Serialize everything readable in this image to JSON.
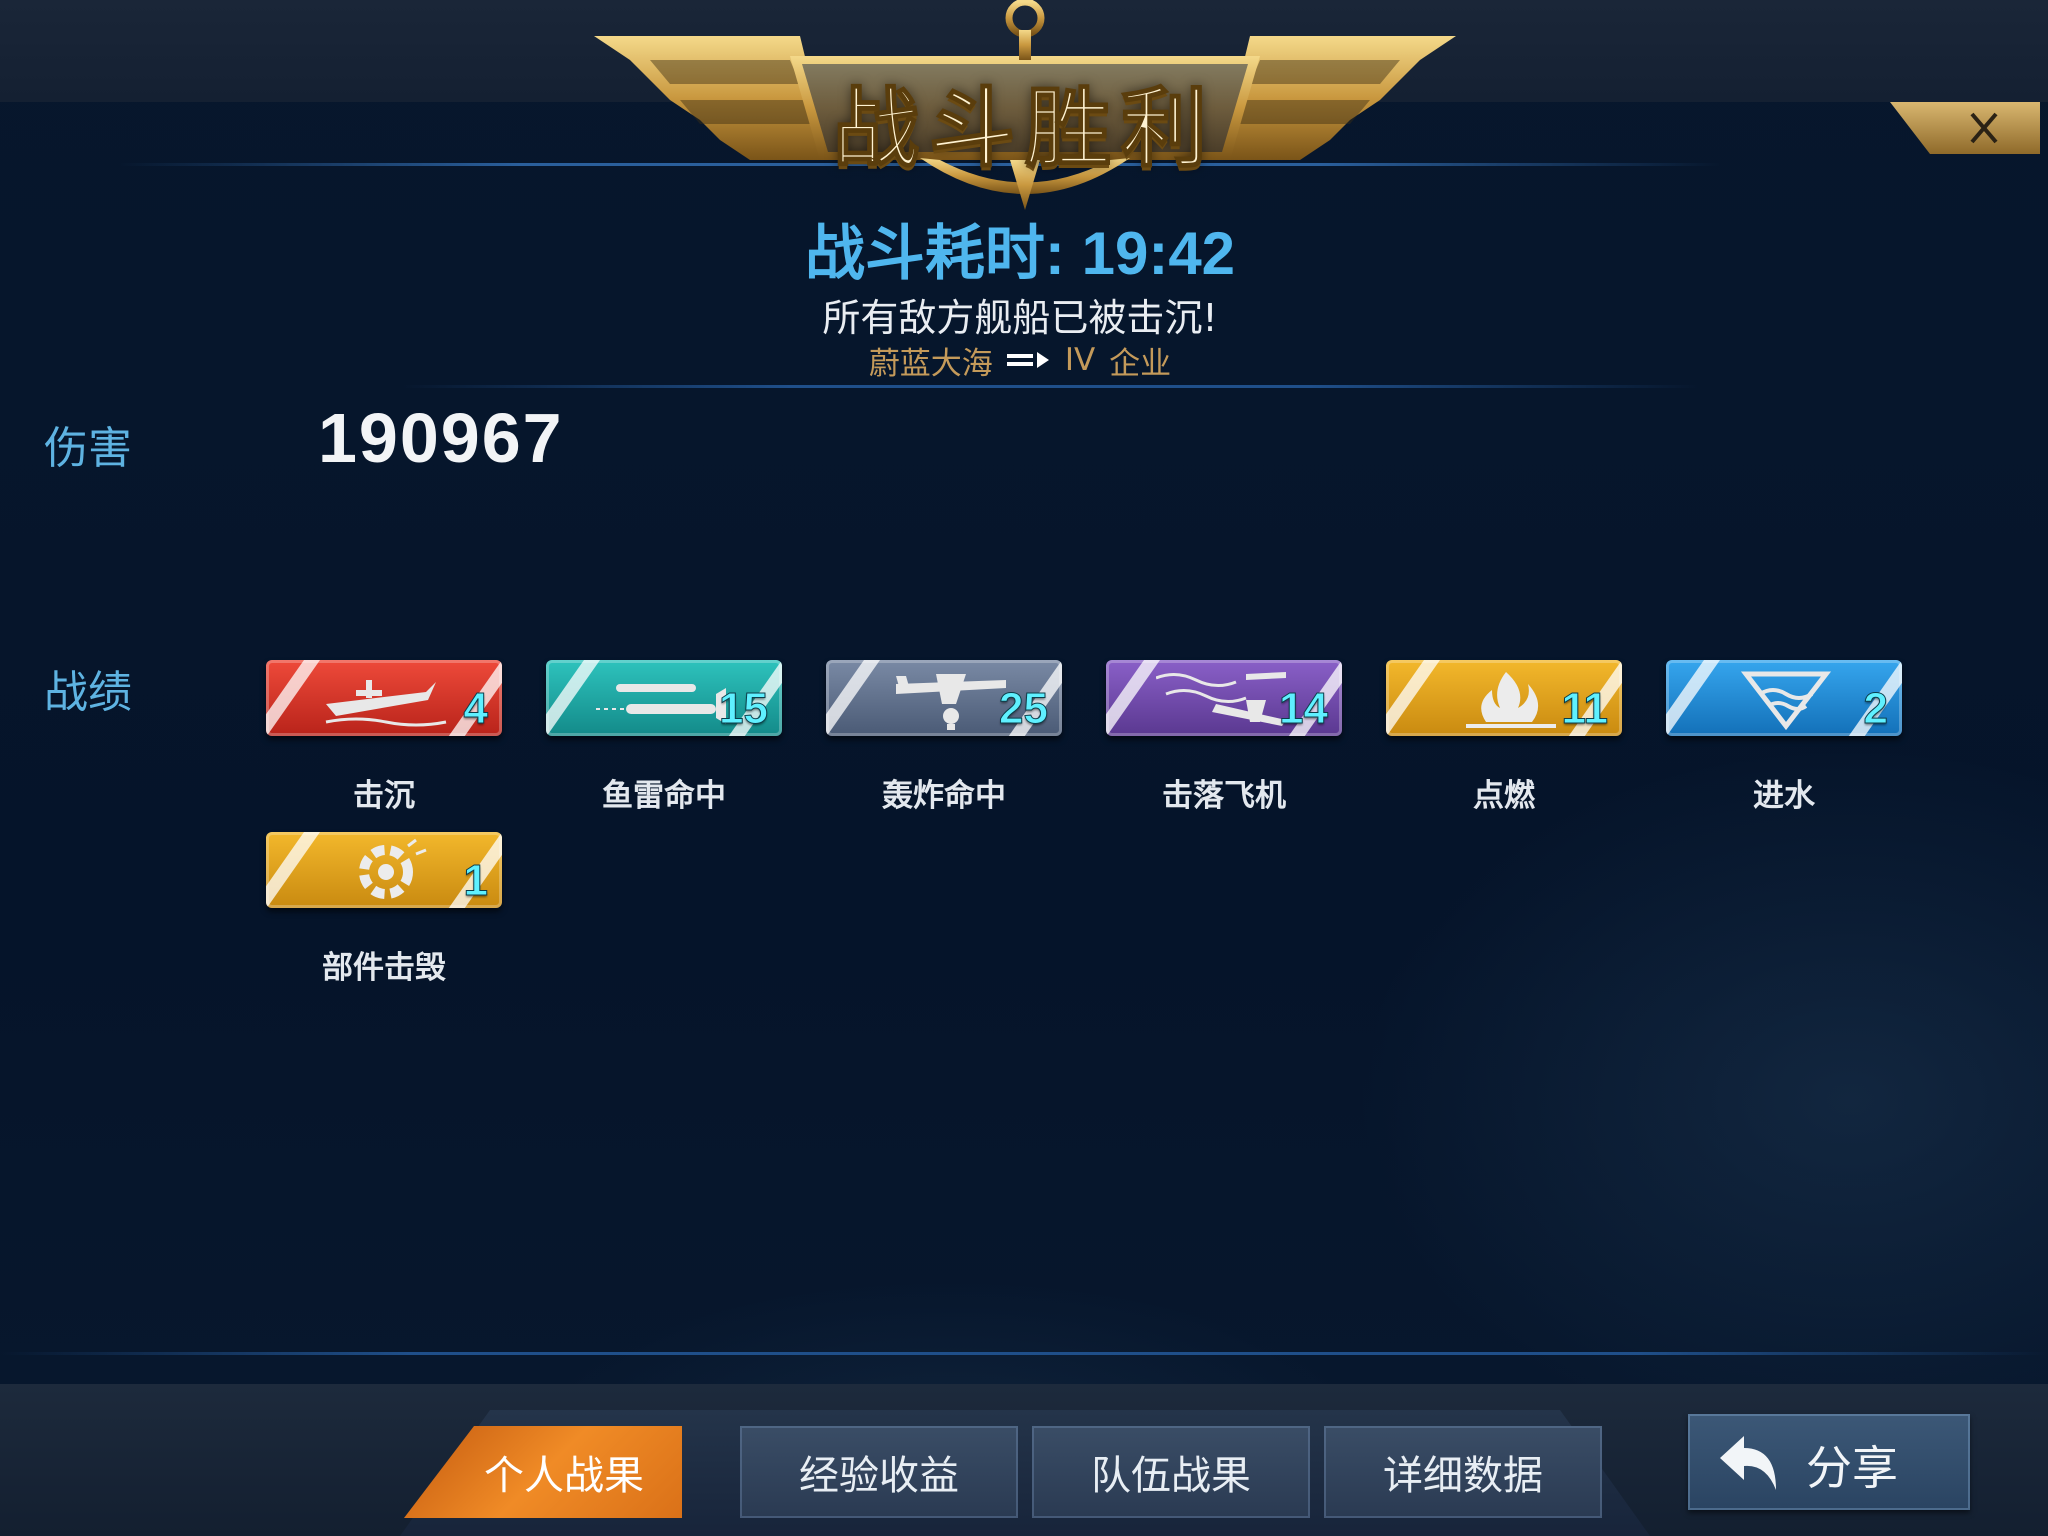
{
  "header": {
    "title": "战斗胜利",
    "close_icon": "close-icon"
  },
  "summary": {
    "duration_label": "战斗耗时:",
    "duration_value": "19:42",
    "result_text": "所有敌方舰船已被击沉!",
    "map_name": "蔚蓝大海",
    "tier": "IV",
    "ship_name": "企业"
  },
  "damage": {
    "label": "伤害",
    "value": "190967"
  },
  "records": {
    "label": "战绩",
    "items": [
      {
        "caption": "击沉",
        "count": "4",
        "icon": "ship-sinking-icon",
        "color": "#d8352a"
      },
      {
        "caption": "鱼雷命中",
        "count": "15",
        "icon": "torpedo-icon",
        "color": "#1aa7a7"
      },
      {
        "caption": "轰炸命中",
        "count": "25",
        "icon": "bomber-icon",
        "color": "#5d6f8c"
      },
      {
        "caption": "击落飞机",
        "count": "14",
        "icon": "plane-shot-down-icon",
        "color": "#6a4aa4"
      },
      {
        "caption": "点燃",
        "count": "11",
        "icon": "fire-icon",
        "color": "#e2a21a"
      },
      {
        "caption": "进水",
        "count": "2",
        "icon": "flooding-icon",
        "color": "#1a8fd8"
      },
      {
        "caption": "部件击毁",
        "count": "1",
        "icon": "module-destroyed-icon",
        "color": "#e2a21a"
      }
    ]
  },
  "tabs": [
    {
      "label": "个人战果",
      "active": true
    },
    {
      "label": "经验收益",
      "active": false
    },
    {
      "label": "队伍战果",
      "active": false
    },
    {
      "label": "详细数据",
      "active": false
    }
  ],
  "share": {
    "label": "分享",
    "icon": "share-arrow-icon"
  }
}
